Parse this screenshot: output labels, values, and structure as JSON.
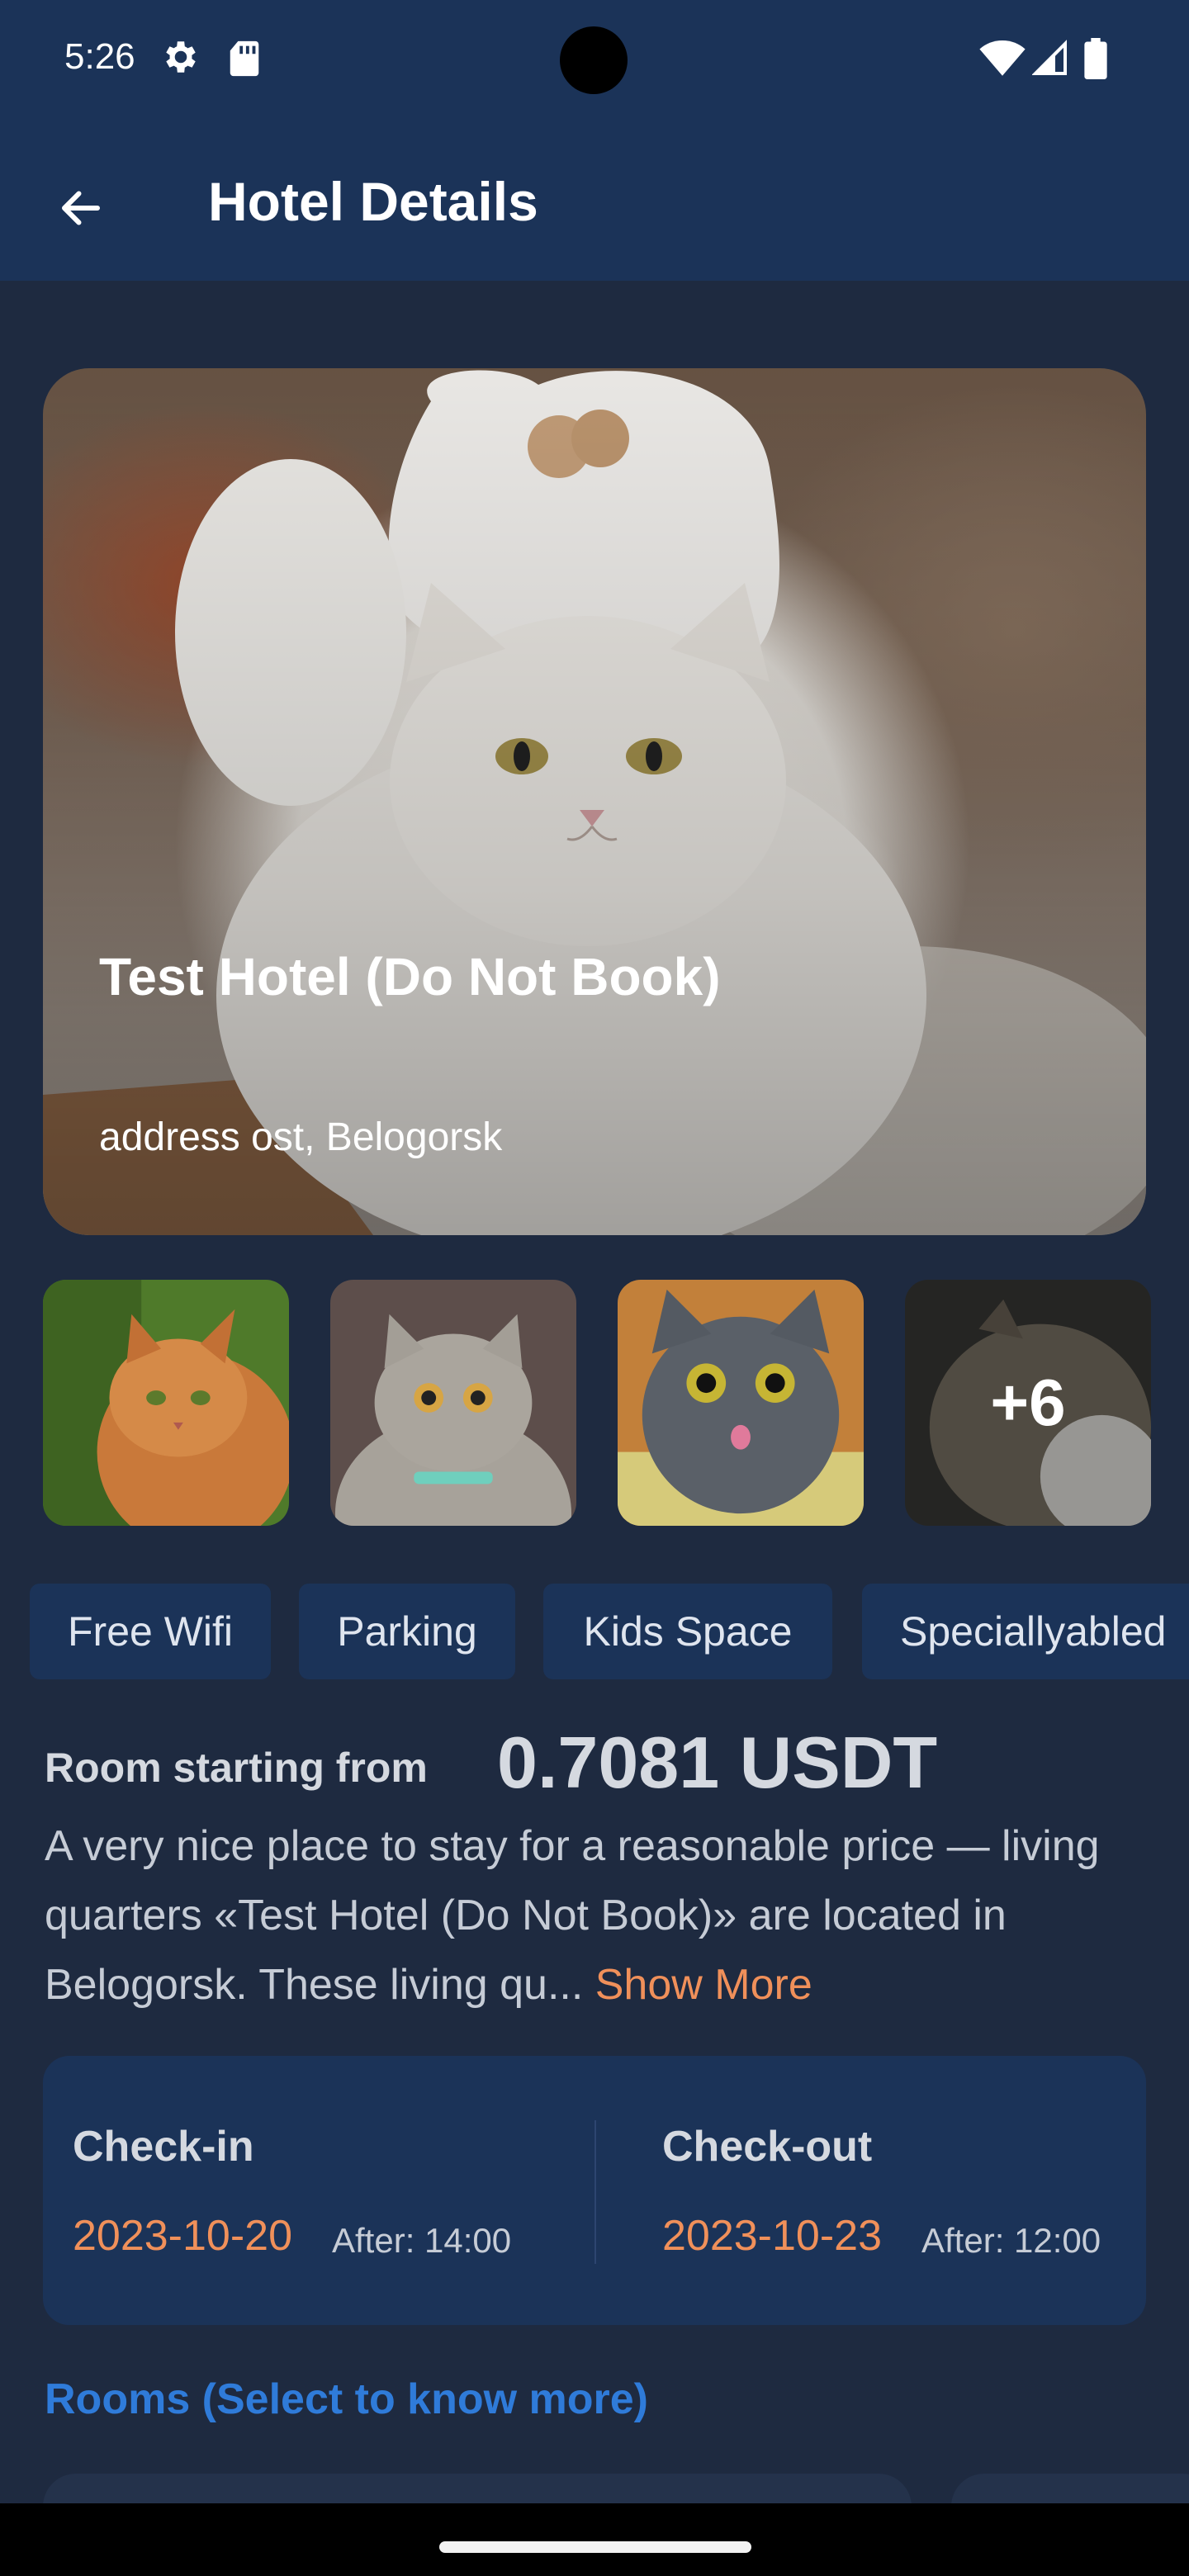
{
  "status_bar": {
    "time": "5:26",
    "icons": [
      "gear-icon",
      "sd-card-icon",
      "wifi-icon",
      "signal-icon",
      "battery-icon"
    ]
  },
  "app_bar": {
    "back_icon": "arrow-left-icon",
    "title": "Hotel Details"
  },
  "hotel": {
    "name": "Test Hotel (Do Not Book)",
    "address": "address ost, Belogorsk"
  },
  "gallery": {
    "more_count": "+6"
  },
  "amenities": [
    "Free Wifi",
    "Parking",
    "Kids Space",
    "Speciallyabled"
  ],
  "pricing": {
    "label": "Room starting from",
    "value": "0.7081 USDT"
  },
  "description": {
    "text": "A very nice place to stay for a reasonable price — living quarters «Test Hotel (Do Not Book)» are located in Belogorsk. These living qu...",
    "show_more": "Show More"
  },
  "check_in": {
    "heading": "Check-in",
    "date": "2023-10-20",
    "after": "After: 14:00"
  },
  "check_out": {
    "heading": "Check-out",
    "date": "2023-10-23",
    "after": "After: 12:00"
  },
  "rooms_link": "Rooms (Select to know more)",
  "colors": {
    "background": "#1e2a40",
    "bar": "#1b3358",
    "accent_orange": "#f0905a",
    "link_blue": "#2f7bd9"
  }
}
